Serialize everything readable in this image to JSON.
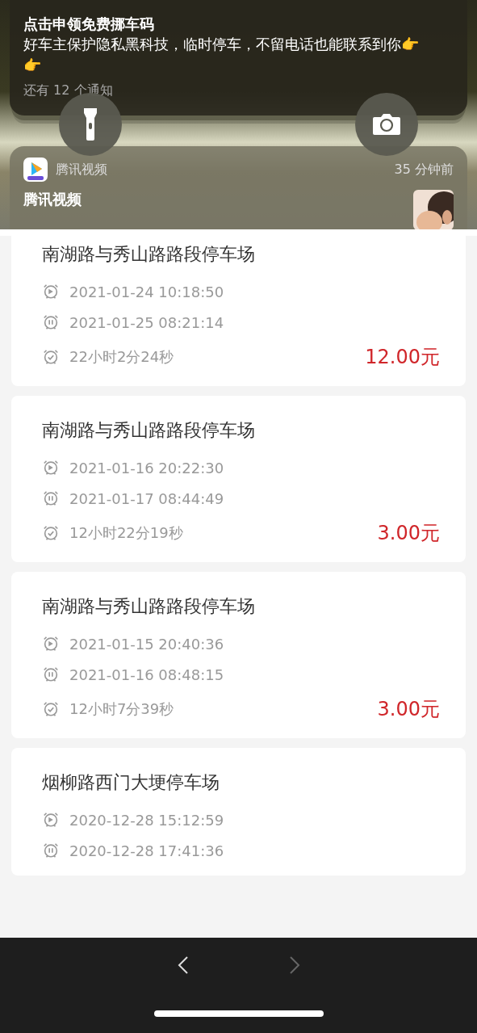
{
  "notifications": [
    {
      "kind": "stack",
      "title": "点击申领免费挪车码",
      "body": "好车主保护隐私黑科技，临时停车，不留电话也能联系到你👉👉",
      "more": "还有 12 个通知"
    },
    {
      "kind": "app",
      "app": "腾讯视频",
      "time": "35 分钟前",
      "title": "腾讯视频"
    }
  ],
  "quick_actions": [
    {
      "kind": "flashlight"
    },
    {
      "kind": "camera"
    }
  ],
  "records": [
    {
      "name": "南湖路与秀山路路段停车场",
      "start": "2021-01-24 10:18:50",
      "end": "2021-01-25 08:21:14",
      "duration": "22小时2分24秒",
      "fee": "12.00元"
    },
    {
      "name": "南湖路与秀山路路段停车场",
      "start": "2021-01-16 20:22:30",
      "end": "2021-01-17 08:44:49",
      "duration": "12小时22分19秒",
      "fee": "3.00元"
    },
    {
      "name": "南湖路与秀山路路段停车场",
      "start": "2021-01-15 20:40:36",
      "end": "2021-01-16 08:48:15",
      "duration": "12小时7分39秒",
      "fee": "3.00元"
    },
    {
      "name": "烟柳路西门大埂停车场",
      "start": "2020-12-28 15:12:59",
      "end": "2020-12-28 17:41:36"
    }
  ],
  "nav": [
    {
      "kind": "back",
      "disabled": false
    },
    {
      "kind": "forward",
      "disabled": true
    }
  ]
}
